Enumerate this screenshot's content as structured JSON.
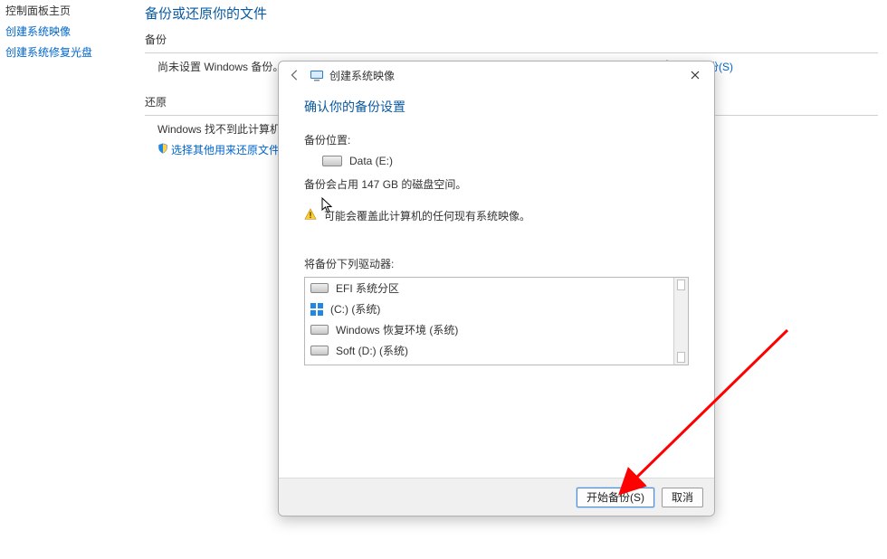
{
  "sidebar": {
    "home": "控制面板主页",
    "links": [
      "创建系统映像",
      "创建系统修复光盘"
    ]
  },
  "main": {
    "title": "备份或还原你的文件",
    "backup_header": "备份",
    "backup_text": "尚未设置 Windows 备份。",
    "backup_link": "设置备份(S)",
    "restore_header": "还原",
    "restore_text": "Windows 找不到此计算机的备份。",
    "restore_link": "选择其他用来还原文件的备份(N)"
  },
  "dialog": {
    "window_title": "创建系统映像",
    "heading": "确认你的备份设置",
    "location_label": "备份位置:",
    "location_value": "Data (E:)",
    "size_text": "备份会占用 147 GB 的磁盘空间。",
    "warn_text": "可能会覆盖此计算机的任何现有系统映像。",
    "drives_label": "将备份下列驱动器:",
    "drives": [
      "EFI 系统分区",
      "(C:) (系统)",
      "Windows 恢复环境 (系统)",
      "Soft (D:) (系统)"
    ],
    "start_btn": "开始备份(S)",
    "cancel_btn": "取消"
  }
}
